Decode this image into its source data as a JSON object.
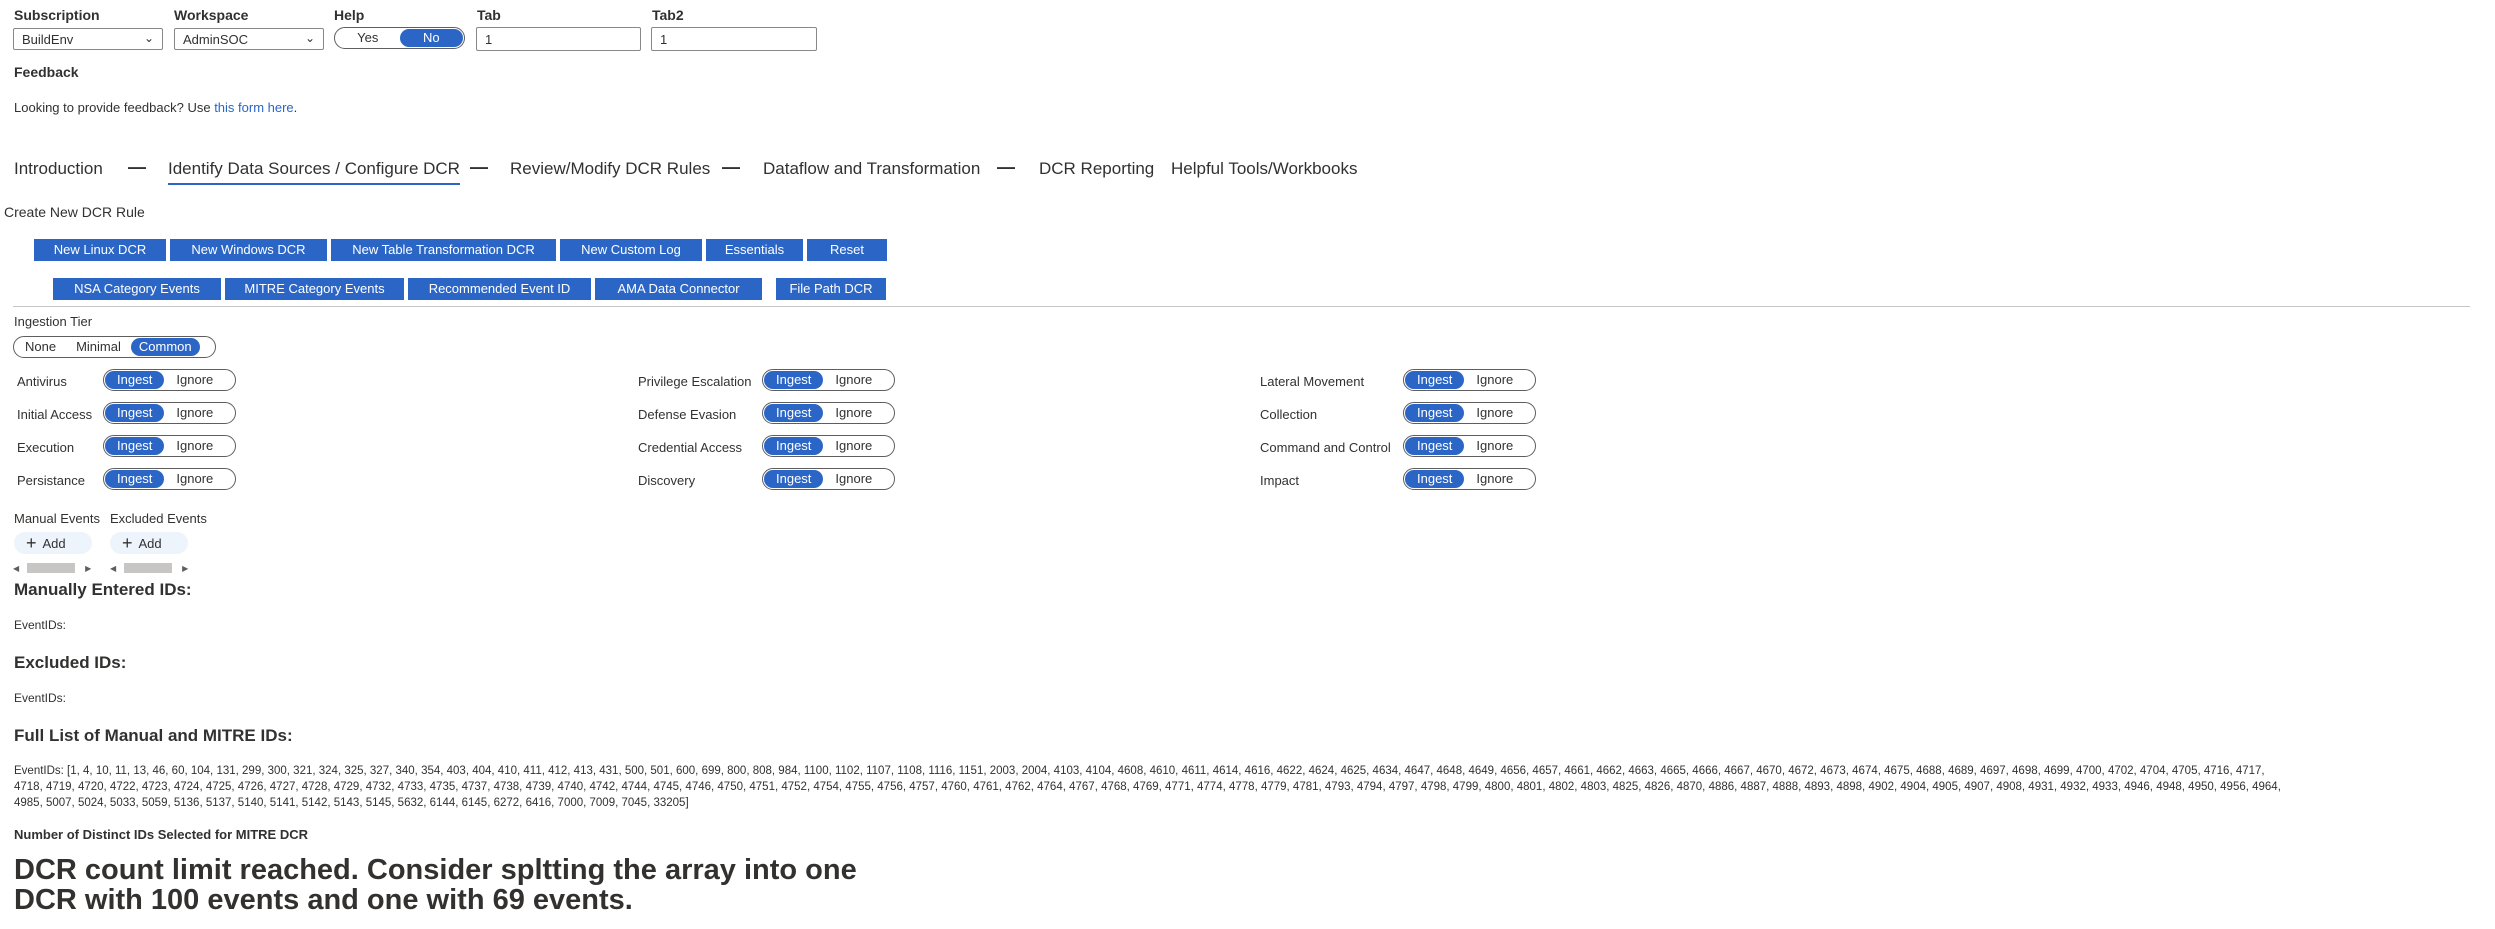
{
  "params": {
    "subscription": {
      "label": "Subscription",
      "value": "BuildEnv"
    },
    "workspace": {
      "label": "Workspace",
      "value": "AdminSOC"
    },
    "help": {
      "label": "Help",
      "yes": "Yes",
      "no": "No",
      "selected": "No"
    },
    "tab": {
      "label": "Tab",
      "value": "1"
    },
    "tab2": {
      "label": "Tab2",
      "value": "1"
    }
  },
  "feedback": {
    "title": "Feedback",
    "text": "Looking to provide feedback? Use ",
    "link": "this form here",
    "suffix": "."
  },
  "tabs": [
    {
      "label": "Introduction"
    },
    {
      "label": "Identify Data Sources / Configure DCR"
    },
    {
      "label": "Review/Modify DCR Rules"
    },
    {
      "label": "Dataflow and Transformation"
    },
    {
      "label": "DCR Reporting"
    },
    {
      "label": "Helpful Tools/Workbooks"
    }
  ],
  "create_title": "Create New DCR Rule",
  "buttons_row1": [
    "New Linux DCR",
    "New Windows DCR",
    "New Table Transformation DCR",
    "New Custom Log",
    "Essentials",
    "Reset"
  ],
  "buttons_row2": [
    "NSA Category Events",
    "MITRE Category Events",
    "Recommended Event ID",
    "AMA Data Connector",
    "File Path DCR"
  ],
  "ingestion": {
    "label": "Ingestion Tier",
    "options": [
      "None",
      "Minimal",
      "Common"
    ],
    "selected": "Common"
  },
  "toggle_labels": {
    "ingest": "Ingest",
    "ignore": "Ignore"
  },
  "tactics": [
    [
      "Antivirus",
      "Privilege Escalation",
      "Lateral Movement"
    ],
    [
      "Initial Access",
      "Defense Evasion",
      "Collection"
    ],
    [
      "Execution",
      "Credential Access",
      "Command and Control"
    ],
    [
      "Persistance",
      "Discovery",
      "Impact"
    ]
  ],
  "manual_events": {
    "label": "Manual Events",
    "add": "Add"
  },
  "excluded_events": {
    "label": "Excluded Events",
    "add": "Add"
  },
  "manual_ids": {
    "title": "Manually Entered IDs:",
    "text": "EventIDs:"
  },
  "excluded_ids": {
    "title": "Excluded IDs:",
    "text": "EventIDs:"
  },
  "full_list": {
    "title": "Full List of Manual and MITRE IDs:",
    "line1": "EventIDs: [1, 4, 10, 11, 13, 46, 60, 104, 131, 299, 300, 321, 324, 325, 327, 340, 354, 403, 404, 410, 411, 412, 413, 431, 500, 501, 600, 699, 800, 808, 984, 1100, 1102, 1107, 1108, 1116, 1151, 2003, 2004, 4103, 4104, 4608, 4610, 4611, 4614, 4616, 4622, 4624, 4625, 4634, 4647, 4648, 4649, 4656, 4657, 4661, 4662, 4663, 4665, 4666, 4667, 4670, 4672, 4673, 4674, 4675, 4688, 4689, 4697, 4698, 4699, 4700, 4702, 4704, 4705, 4716, 4717,",
    "line2": "4718, 4719, 4720, 4722, 4723, 4724, 4725, 4726, 4727, 4728, 4729, 4732, 4733, 4735, 4737, 4738, 4739, 4740, 4742, 4744, 4745, 4746, 4750, 4751, 4752, 4754, 4755, 4756, 4757, 4760, 4761, 4762, 4764, 4767, 4768, 4769, 4771, 4774, 4778, 4779, 4781, 4793, 4794, 4797, 4798, 4799, 4800, 4801, 4802, 4803, 4825, 4826, 4870, 4886, 4887, 4888, 4893, 4898, 4902, 4904, 4905, 4907, 4908, 4931, 4932, 4933, 4946, 4948, 4950, 4956, 4964,",
    "line3": "4985, 5007, 5024, 5033, 5059, 5136, 5137, 5140, 5141, 5142, 5143, 5145, 5632, 6144, 6145, 6272, 6416, 7000, 7009, 7045, 33205]"
  },
  "distinct": {
    "title": "Number of Distinct IDs Selected for MITRE DCR",
    "line1": "DCR count limit reached. Consider spltting the array into one",
    "line2": "DCR with 100 events and one with 69 events."
  },
  "colors": {
    "accent": "#2b66c7"
  }
}
